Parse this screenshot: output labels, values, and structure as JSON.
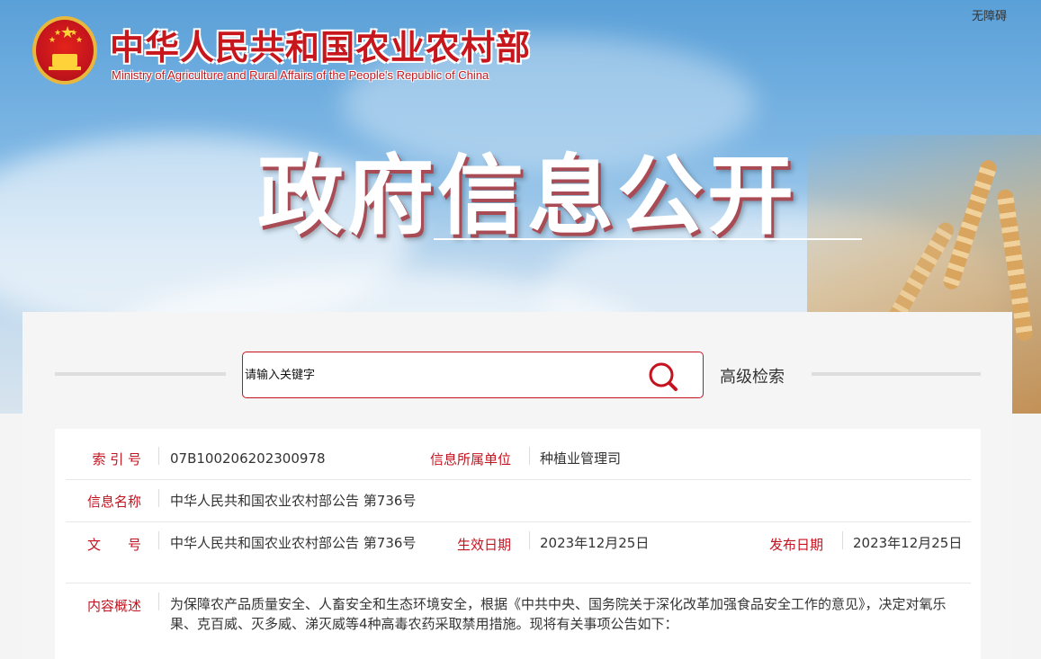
{
  "header": {
    "ministry_cn": "中华人民共和国农业农村部",
    "ministry_en": "Ministry of Agriculture and Rural Affairs of the People's Republic of China",
    "accessibility": "无障碍",
    "banner_title": "政府信息公开"
  },
  "search": {
    "placeholder": "请输入关键字",
    "advanced_label": "高级检索"
  },
  "info": {
    "index_label": "索 引 号",
    "index_value": "07B100206202300978",
    "unit_label": "信息所属单位",
    "unit_value": "种植业管理司",
    "name_label": "信息名称",
    "name_value": "中华人民共和国农业农村部公告 第736号",
    "doc_label": "文　　号",
    "doc_value": "中华人民共和国农业农村部公告 第736号",
    "effective_label": "生效日期",
    "effective_value": "2023年12月25日",
    "publish_label": "发布日期",
    "publish_value": "2023年12月25日",
    "summary_label": "内容概述",
    "summary_value": "为保障农产品质量安全、人畜安全和生态环境安全，根据《中共中央、国务院关于深化改革加强食品安全工作的意见》，决定对氧乐果、克百威、灭多威、涕灭威等4种高毒农药采取禁用措施。现将有关事项公告如下："
  },
  "colors": {
    "accent_red": "#c5121f",
    "banner_sky": "#7db6e4"
  },
  "icons": [
    "national-emblem-icon",
    "search-icon"
  ]
}
